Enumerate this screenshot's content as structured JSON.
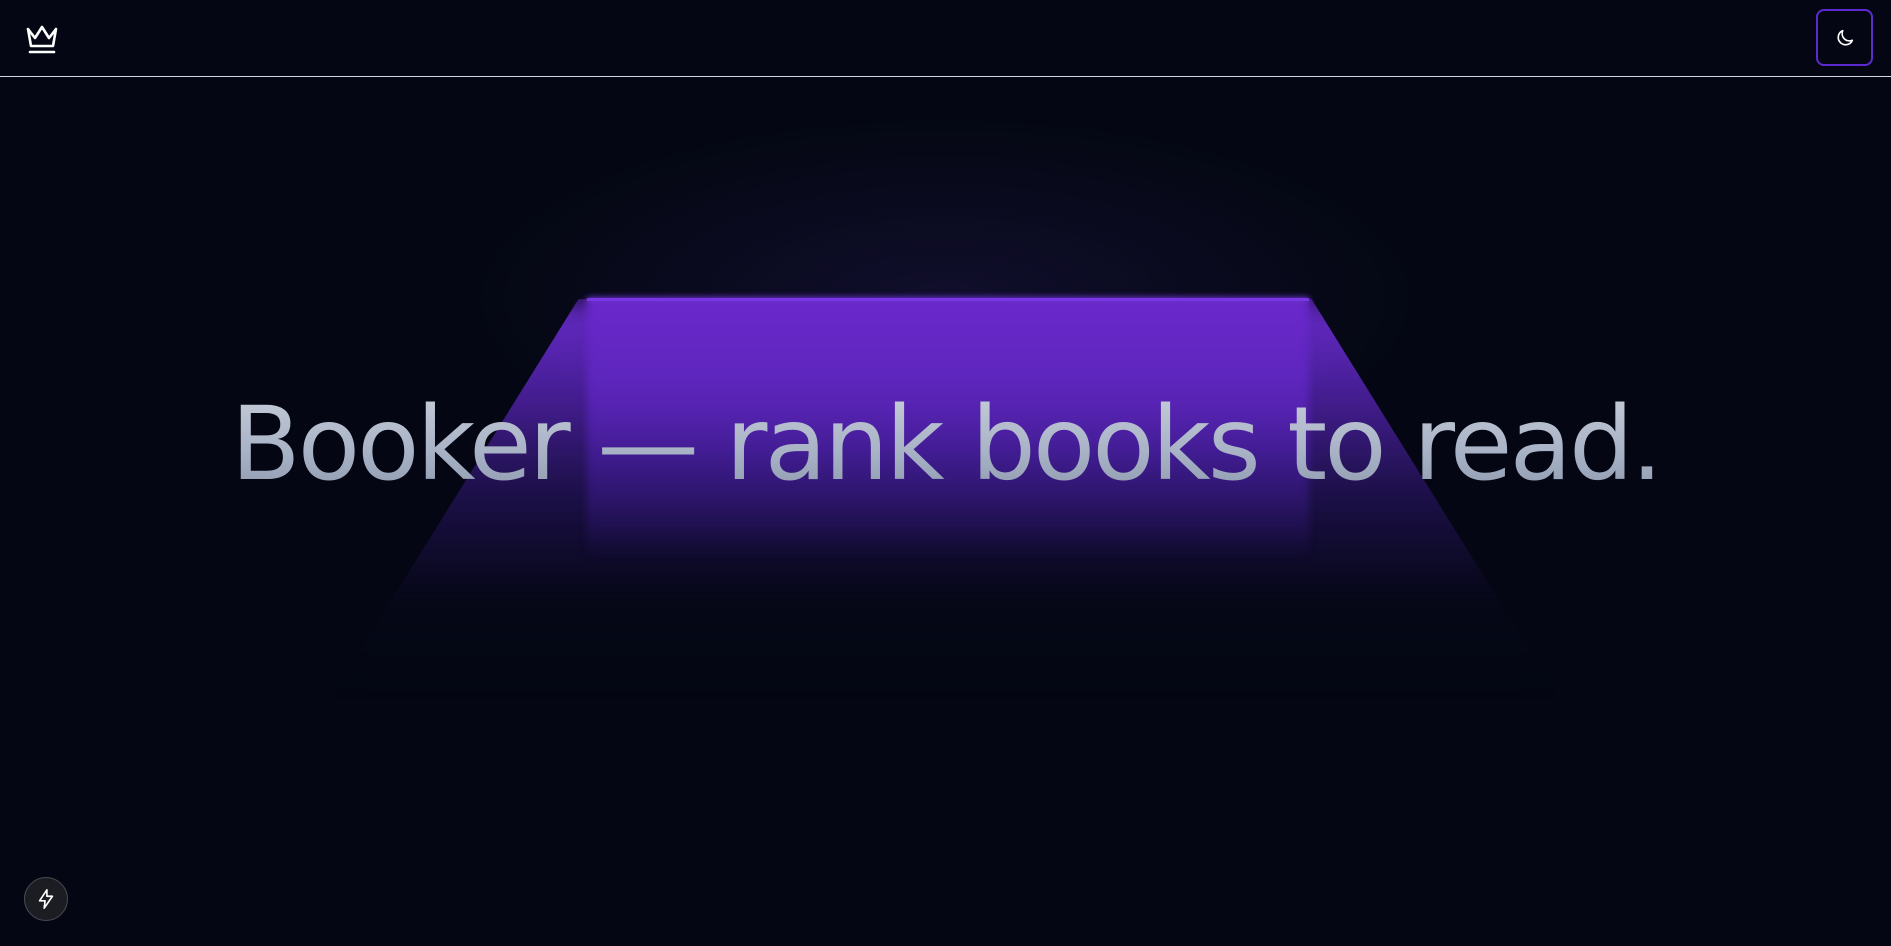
{
  "header": {
    "logo_icon": "crown-icon",
    "theme_toggle_icon": "moon-icon"
  },
  "hero": {
    "headline": "Booker — rank books to read."
  },
  "fab": {
    "icon": "lightning-bolt-icon"
  },
  "colors": {
    "background": "#040713",
    "accent": "#6a28cc",
    "toggle_border": "#5b2bd0",
    "headline": "#a9b3c6"
  }
}
